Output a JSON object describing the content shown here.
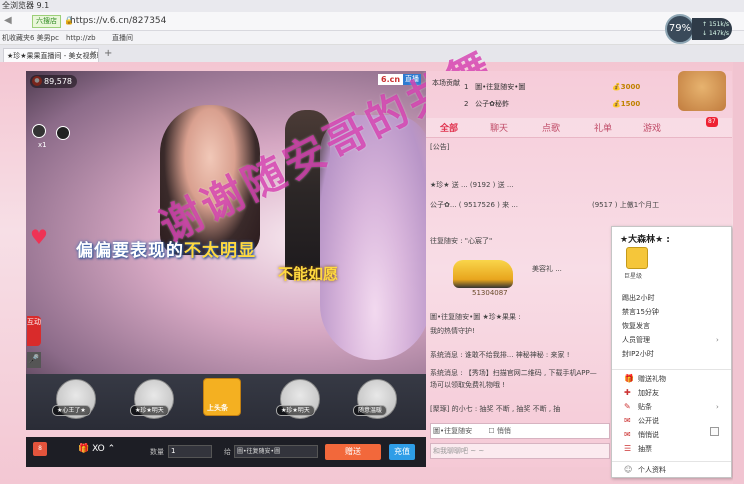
{
  "browser": {
    "title": "全浏览器 9.1",
    "security_badge": "六搜店",
    "url": "https://v.6.cn/827354",
    "bookmarks": [
      "机收藏夹",
      "6 美男pc",
      "http://zb",
      "直播间"
    ],
    "tab_title": "★珍★果果直播间 - 美女视频聊",
    "speed_percent": "79",
    "speed_up": "151k/s",
    "speed_down": "147k/s"
  },
  "video": {
    "viewer_count": "89,578",
    "site_logo": "6.cn",
    "live_tag": "直播",
    "host_count": "x1",
    "lyric_line1_plain": "偏偏要表现的",
    "lyric_line1_highlight": "不太明显",
    "lyric_line2": "不能如愿",
    "overlay_text": "谢谢随安哥的共舞",
    "live_button": "互动",
    "mic_icon": "mic-icon"
  },
  "gifts": {
    "items": [
      {
        "label": "★心王了★"
      },
      {
        "label": "★珍★明天"
      },
      {
        "label": "上头条"
      },
      {
        "label": "★珍★明天"
      },
      {
        "label": "随意温暖"
      }
    ]
  },
  "bottom_bar": {
    "gift_button": "XO",
    "gift_badge": "8",
    "qty_label": "数量",
    "qty_value": "1",
    "to_label": "给",
    "to_value": "圖•往复随安•圖",
    "send_label": "赠送",
    "recharge_label": "充值"
  },
  "ranking": {
    "label": "本场贡献",
    "rows": [
      {
        "rank": "1",
        "name": "圖•往复随安•圖",
        "coins": "3000"
      },
      {
        "rank": "2",
        "name": "公子✿秘鈼",
        "coins": "1500"
      }
    ]
  },
  "tabs": {
    "items": [
      "全部",
      "聊天",
      "点歌",
      "礼单",
      "游戏"
    ],
    "badge": "87"
  },
  "chat": {
    "lines": [
      "[公告]",
      "★珍★ 送 ... (9192 ) 送 ...",
      "公子✿... ( 9517526 ) 来 ...",
      "(9517 ) 上傲1个月工",
      "往复随安 : \"心宸了\"",
      "美容礼 ...",
      "51304087",
      "圖•往复随安•圖 ★珍★果果 :",
      "我的热情守护!",
      "系统消息 : 谁敢不给我排... 神秘神秘 : 来家 !",
      "系统消息 : 【秀场】扫描官网二维码 , 下载手机APP—",
      "场可以领取免费礼物哦 !",
      "[聚琢] 的小七 : 抽奖 不断 , 抽奖 不断 , 抽"
    ],
    "car_number": "51304087",
    "input_to": "圖•往复随安",
    "input_private": "悄悄",
    "input_placeholder": "和我聊聊吧 ~ ~"
  },
  "context_menu": {
    "title": "★大森林★ :",
    "badge": "巨星级",
    "items": [
      {
        "label": "踢出2小时",
        "has_arrow": false
      },
      {
        "label": "禁言15分钟",
        "has_arrow": false
      },
      {
        "label": "恢复发言",
        "has_arrow": false
      },
      {
        "label": "人员管理",
        "has_arrow": true
      },
      {
        "label": "封IP2小时",
        "has_arrow": false
      }
    ],
    "items2": [
      {
        "label": "赠送礼物",
        "icon": "gift-icon",
        "has_arrow": false
      },
      {
        "label": "加好友",
        "icon": "add-friend-icon",
        "has_arrow": false
      },
      {
        "label": "贴条",
        "icon": "note-icon",
        "has_arrow": true
      },
      {
        "label": "公开说",
        "icon": "chat-icon",
        "has_arrow": false
      },
      {
        "label": "悄悄说",
        "icon": "whisper-icon",
        "has_arrow": false
      },
      {
        "label": "抽票",
        "icon": "ticket-icon",
        "has_arrow": false
      }
    ],
    "footer": "个人资料"
  }
}
